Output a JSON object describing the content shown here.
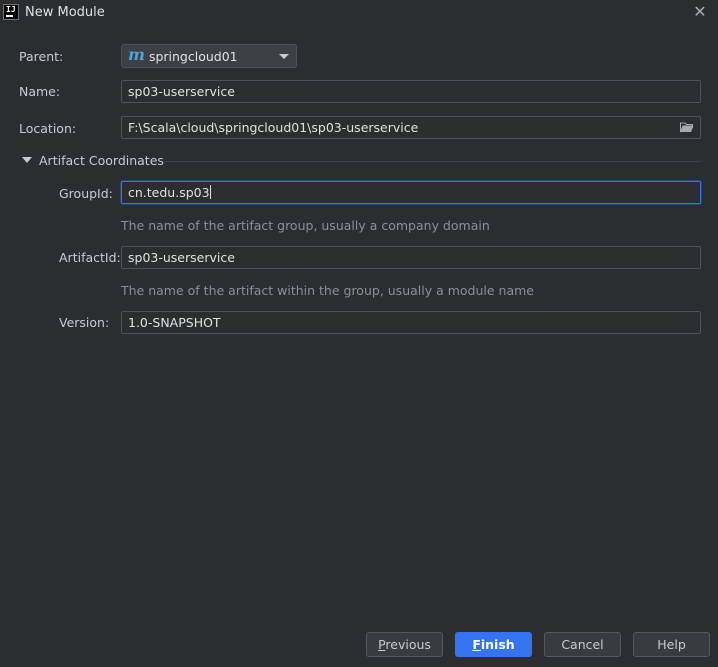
{
  "window": {
    "title": "New Module",
    "app_icon_text": "IJ"
  },
  "form": {
    "parent": {
      "label": "Parent:",
      "value": "springcloud01",
      "icon": "maven-icon"
    },
    "name": {
      "label": "Name:",
      "value": "sp03-userservice"
    },
    "location": {
      "label": "Location:",
      "value": "F:\\Scala\\cloud\\springcloud01\\sp03-userservice",
      "icon": "folder-icon"
    }
  },
  "artifact_coordinates": {
    "title": "Artifact Coordinates",
    "expanded": true,
    "group_id": {
      "label": "GroupId:",
      "value": "cn.tedu.sp03",
      "hint": "The name of the artifact group, usually a company domain"
    },
    "artifact_id": {
      "label": "ArtifactId:",
      "value": "sp03-userservice",
      "hint": "The name of the artifact within the group, usually a module name"
    },
    "version": {
      "label": "Version:",
      "value": "1.0-SNAPSHOT"
    }
  },
  "buttons": {
    "previous": {
      "mnemonic": "P",
      "rest": "revious"
    },
    "finish": {
      "mnemonic": "F",
      "rest": "inish"
    },
    "cancel": "Cancel",
    "help": "Help"
  },
  "colors": {
    "background": "#2b2d30",
    "accent": "#3574f0",
    "maven_icon": "#4aa4e0"
  }
}
